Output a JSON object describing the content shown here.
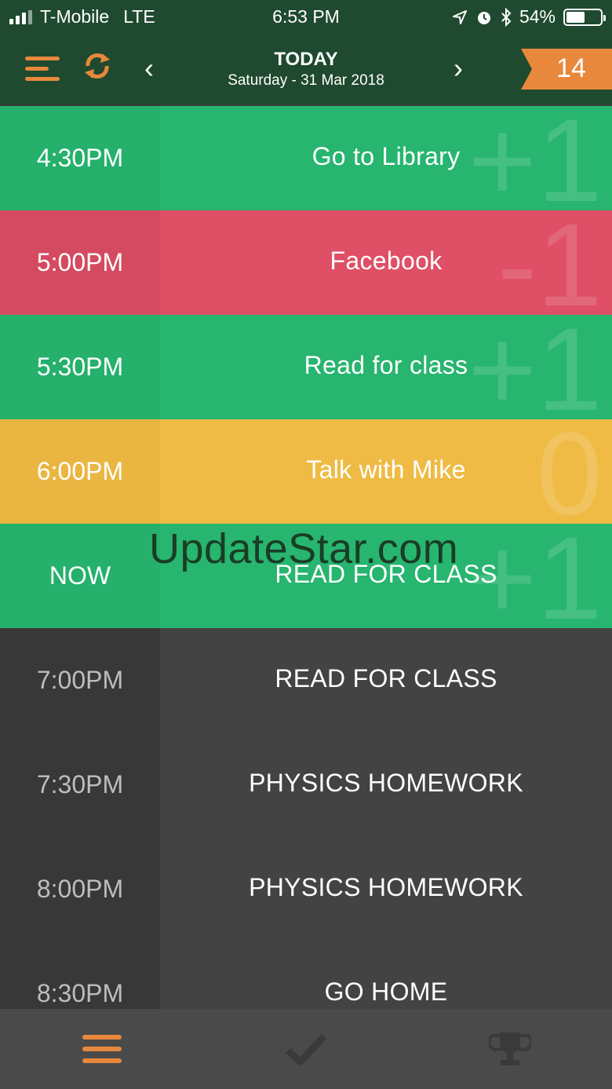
{
  "status": {
    "carrier": "T-Mobile",
    "network": "LTE",
    "time": "6:53 PM",
    "battery": "54%",
    "battery_level": 0.54
  },
  "nav": {
    "title": "TODAY",
    "date": "Saturday - 31 Mar 2018",
    "badge": "14"
  },
  "colors": {
    "green": "#27b56f",
    "green_time": "#25b06b",
    "red": "#df4f66",
    "red_time": "#d44a60",
    "yellow": "#efbb45",
    "yellow_time": "#eab641",
    "dark": "#434343",
    "dark_time": "#383838",
    "accent": "#e8883c"
  },
  "rows": [
    {
      "time": "4:30PM",
      "task": "Go to Library",
      "score": "+1"
    },
    {
      "time": "5:00PM",
      "task": "Facebook",
      "score": "-1"
    },
    {
      "time": "5:30PM",
      "task": "Read for class",
      "score": "+1"
    },
    {
      "time": "6:00PM",
      "task": "Talk with Mike",
      "score": "0"
    },
    {
      "time": "NOW",
      "task": "READ FOR CLASS",
      "score": "+1"
    },
    {
      "time": "7:00PM",
      "task": "READ FOR CLASS",
      "score": ""
    },
    {
      "time": "7:30PM",
      "task": "PHYSICS HOMEWORK",
      "score": ""
    },
    {
      "time": "8:00PM",
      "task": "PHYSICS HOMEWORK",
      "score": ""
    },
    {
      "time": "8:30PM",
      "task": "GO HOME",
      "score": ""
    }
  ],
  "watermark": "UpdateStar.com",
  "tabs": [
    {
      "icon": "list-icon",
      "active": true
    },
    {
      "icon": "checkmark-icon",
      "active": false
    },
    {
      "icon": "trophy-icon",
      "active": false
    }
  ]
}
